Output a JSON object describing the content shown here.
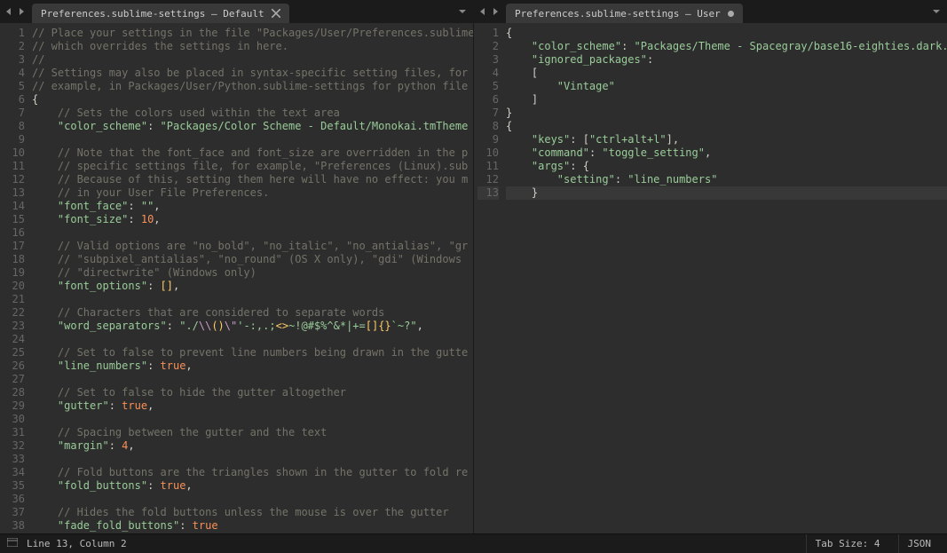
{
  "left": {
    "tab_title": "Preferences.sublime-settings — Default",
    "lines": [
      [
        [
          "comment",
          "// Place your settings in the file \"Packages/User/Preferences.sublime"
        ]
      ],
      [
        [
          "comment",
          "// which overrides the settings in here."
        ]
      ],
      [
        [
          "comment",
          "//"
        ]
      ],
      [
        [
          "comment",
          "// Settings may also be placed in syntax-specific setting files, for"
        ]
      ],
      [
        [
          "comment",
          "// example, in Packages/User/Python.sublime-settings for python file"
        ]
      ],
      [
        [
          "punct",
          "{"
        ]
      ],
      [
        [
          "plain",
          "    "
        ],
        [
          "comment",
          "// Sets the colors used within the text area"
        ]
      ],
      [
        [
          "plain",
          "    "
        ],
        [
          "key",
          "\"color_scheme\""
        ],
        [
          "punct",
          ": "
        ],
        [
          "string",
          "\"Packages/Color Scheme - Default/Monokai.tmTheme"
        ]
      ],
      [],
      [
        [
          "plain",
          "    "
        ],
        [
          "comment",
          "// Note that the font_face and font_size are overridden in the p"
        ]
      ],
      [
        [
          "plain",
          "    "
        ],
        [
          "comment",
          "// specific settings file, for example, \"Preferences (Linux).sub"
        ]
      ],
      [
        [
          "plain",
          "    "
        ],
        [
          "comment",
          "// Because of this, setting them here will have no effect: you m"
        ]
      ],
      [
        [
          "plain",
          "    "
        ],
        [
          "comment",
          "// in your User File Preferences."
        ]
      ],
      [
        [
          "plain",
          "    "
        ],
        [
          "key",
          "\"font_face\""
        ],
        [
          "punct",
          ": "
        ],
        [
          "string",
          "\"\""
        ],
        [
          "punct",
          ","
        ]
      ],
      [
        [
          "plain",
          "    "
        ],
        [
          "key",
          "\"font_size\""
        ],
        [
          "punct",
          ": "
        ],
        [
          "num",
          "10"
        ],
        [
          "punct",
          ","
        ]
      ],
      [],
      [
        [
          "plain",
          "    "
        ],
        [
          "comment",
          "// Valid options are \"no_bold\", \"no_italic\", \"no_antialias\", \"gr"
        ]
      ],
      [
        [
          "plain",
          "    "
        ],
        [
          "comment",
          "// \"subpixel_antialias\", \"no_round\" (OS X only), \"gdi\" (Windows "
        ]
      ],
      [
        [
          "plain",
          "    "
        ],
        [
          "comment",
          "// \"directwrite\" (Windows only)"
        ]
      ],
      [
        [
          "plain",
          "    "
        ],
        [
          "key",
          "\"font_options\""
        ],
        [
          "punct",
          ": "
        ],
        [
          "brackpair",
          "[]"
        ],
        [
          "punct",
          ","
        ]
      ],
      [],
      [
        [
          "plain",
          "    "
        ],
        [
          "comment",
          "// Characters that are considered to separate words"
        ]
      ],
      [
        [
          "plain",
          "    "
        ],
        [
          "key",
          "\"word_separators\""
        ],
        [
          "punct",
          ": "
        ],
        [
          "string",
          "\"./"
        ],
        [
          "esc",
          "\\\\"
        ],
        [
          "brackpair",
          "()"
        ],
        [
          "esc",
          "\\\""
        ],
        [
          "string",
          "'-:,.;"
        ],
        [
          "brackpair",
          "<>"
        ],
        [
          "string",
          "~!@#$%^&*|+="
        ],
        [
          "brackpair",
          "[]{}"
        ],
        [
          "string",
          "`~?\""
        ],
        [
          "punct",
          ","
        ]
      ],
      [],
      [
        [
          "plain",
          "    "
        ],
        [
          "comment",
          "// Set to false to prevent line numbers being drawn in the gutte"
        ]
      ],
      [
        [
          "plain",
          "    "
        ],
        [
          "key",
          "\"line_numbers\""
        ],
        [
          "punct",
          ": "
        ],
        [
          "bool",
          "true"
        ],
        [
          "punct",
          ","
        ]
      ],
      [],
      [
        [
          "plain",
          "    "
        ],
        [
          "comment",
          "// Set to false to hide the gutter altogether"
        ]
      ],
      [
        [
          "plain",
          "    "
        ],
        [
          "key",
          "\"gutter\""
        ],
        [
          "punct",
          ": "
        ],
        [
          "bool",
          "true"
        ],
        [
          "punct",
          ","
        ]
      ],
      [],
      [
        [
          "plain",
          "    "
        ],
        [
          "comment",
          "// Spacing between the gutter and the text"
        ]
      ],
      [
        [
          "plain",
          "    "
        ],
        [
          "key",
          "\"margin\""
        ],
        [
          "punct",
          ": "
        ],
        [
          "num",
          "4"
        ],
        [
          "punct",
          ","
        ]
      ],
      [],
      [
        [
          "plain",
          "    "
        ],
        [
          "comment",
          "// Fold buttons are the triangles shown in the gutter to fold re"
        ]
      ],
      [
        [
          "plain",
          "    "
        ],
        [
          "key",
          "\"fold_buttons\""
        ],
        [
          "punct",
          ": "
        ],
        [
          "bool",
          "true"
        ],
        [
          "punct",
          ","
        ]
      ],
      [],
      [
        [
          "plain",
          "    "
        ],
        [
          "comment",
          "// Hides the fold buttons unless the mouse is over the gutter"
        ]
      ],
      [
        [
          "plain",
          "    "
        ],
        [
          "key",
          "\"fade_fold_buttons\""
        ],
        [
          "punct",
          ": "
        ],
        [
          "bool",
          "true"
        ]
      ]
    ],
    "line_start": 1
  },
  "right": {
    "tab_title": "Preferences.sublime-settings — User",
    "dirty": true,
    "highlight_line": 13,
    "lines": [
      [
        [
          "punct",
          "{"
        ]
      ],
      [
        [
          "plain",
          "    "
        ],
        [
          "key",
          "\"color_scheme\""
        ],
        [
          "punct",
          ": "
        ],
        [
          "string",
          "\"Packages/Theme - Spacegray/base16-eighties.dark."
        ]
      ],
      [
        [
          "plain",
          "    "
        ],
        [
          "key",
          "\"ignored_packages\""
        ],
        [
          "punct",
          ":"
        ]
      ],
      [
        [
          "plain",
          "    "
        ],
        [
          "punct",
          "["
        ]
      ],
      [
        [
          "plain",
          "        "
        ],
        [
          "string",
          "\"Vintage\""
        ]
      ],
      [
        [
          "plain",
          "    "
        ],
        [
          "punct",
          "]"
        ]
      ],
      [
        [
          "punct",
          "}"
        ]
      ],
      [
        [
          "punct",
          "{"
        ]
      ],
      [
        [
          "plain",
          "    "
        ],
        [
          "key",
          "\"keys\""
        ],
        [
          "punct",
          ": ["
        ],
        [
          "string",
          "\"ctrl+alt+l\""
        ],
        [
          "punct",
          "],"
        ]
      ],
      [
        [
          "plain",
          "    "
        ],
        [
          "key",
          "\"command\""
        ],
        [
          "punct",
          ": "
        ],
        [
          "string",
          "\"toggle_setting\""
        ],
        [
          "punct",
          ","
        ]
      ],
      [
        [
          "plain",
          "    "
        ],
        [
          "key",
          "\"args\""
        ],
        [
          "punct",
          ": {"
        ]
      ],
      [
        [
          "plain",
          "        "
        ],
        [
          "key",
          "\"setting\""
        ],
        [
          "punct",
          ": "
        ],
        [
          "string",
          "\"line_numbers\""
        ]
      ],
      [
        [
          "plain",
          "    "
        ],
        [
          "punct",
          "}"
        ]
      ]
    ],
    "line_start": 1
  },
  "status": {
    "cursor": "Line 13, Column 2",
    "tab_size": "Tab Size: 4",
    "syntax": "JSON"
  }
}
